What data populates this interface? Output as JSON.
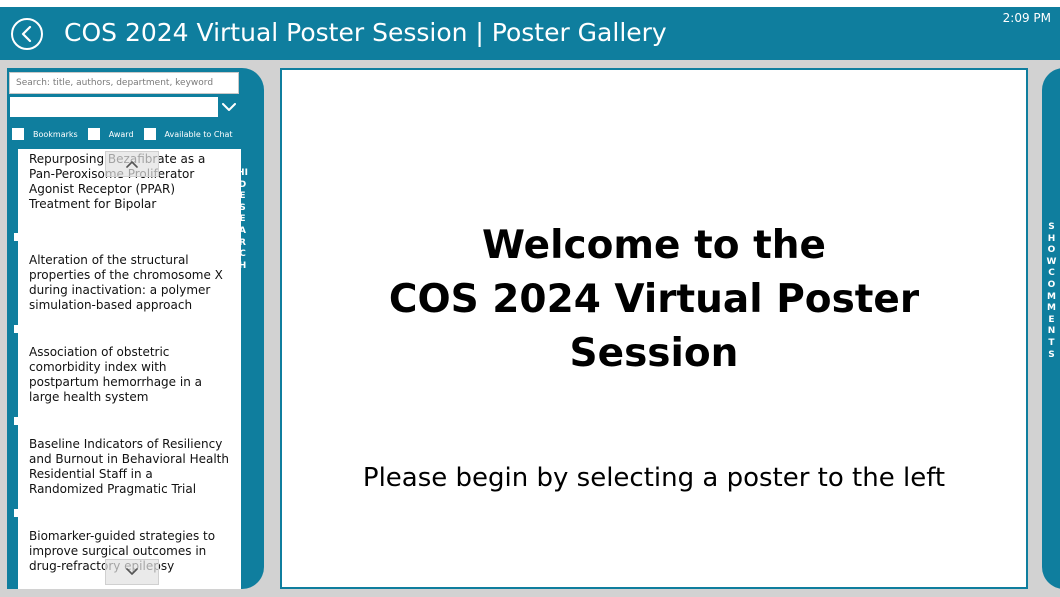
{
  "header": {
    "title": "COS 2024 Virtual Poster Session | Poster Gallery",
    "time": "2:09 PM",
    "back_icon": "chevron-left-circle-icon",
    "color": "#0f7e9e"
  },
  "sidebar": {
    "search_placeholder": "Search: title, authors, department, keyword",
    "dropdown_value": "",
    "filters": [
      {
        "label": "Bookmarks"
      },
      {
        "label": "Award"
      },
      {
        "label": "Available to Chat"
      }
    ],
    "posters": [
      {
        "title": "Repurposing Bezafibrate as a Pan-Peroxisome Proliferator Agonist Receptor (PPAR) Treatment for Bipolar"
      },
      {
        "title": "Alteration of the structural properties of the chromosome X during inactivation: a polymer simulation-based approach"
      },
      {
        "title": "Association of obstetric comorbidity index with postpartum hemorrhage in a large health system"
      },
      {
        "title": "Baseline Indicators of Resiliency and Burnout in Behavioral Health Residential Staff in a Randomized Pragmatic Trial"
      },
      {
        "title": "Biomarker-guided strategies to improve surgical outcomes in drug-refractory epilepsy"
      }
    ],
    "hide_label": "HIDE SEARCH"
  },
  "main": {
    "welcome_line1": "Welcome to the",
    "welcome_line2": "COS 2024 Virtual Poster",
    "welcome_line3": "Session",
    "subtitle": "Please begin by selecting a poster to the left"
  },
  "comments": {
    "label": "SHOW COMMENTS"
  }
}
